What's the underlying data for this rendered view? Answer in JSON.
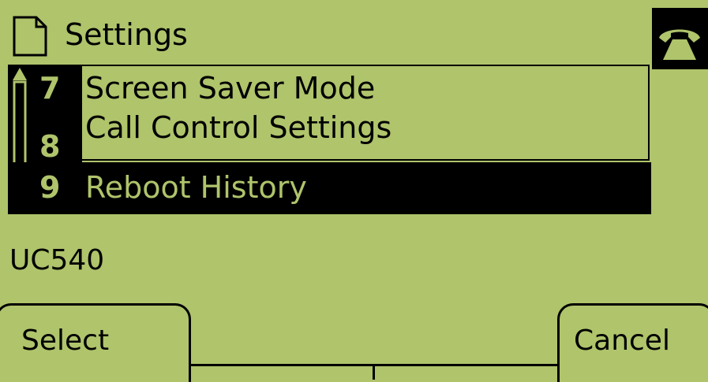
{
  "header": {
    "title": "Settings"
  },
  "menu": {
    "items": [
      {
        "number": "7",
        "label": "Screen Saver Mode"
      },
      {
        "number": "8",
        "label": "Call Control Settings"
      },
      {
        "number": "9",
        "label": "Reboot History"
      }
    ],
    "selected_item_number": "9"
  },
  "status": {
    "text": "UC540"
  },
  "softkeys": {
    "select": "Select",
    "cancel": "Cancel"
  },
  "colors": {
    "lcd_background": "#afc46b",
    "foreground": "#000000"
  }
}
